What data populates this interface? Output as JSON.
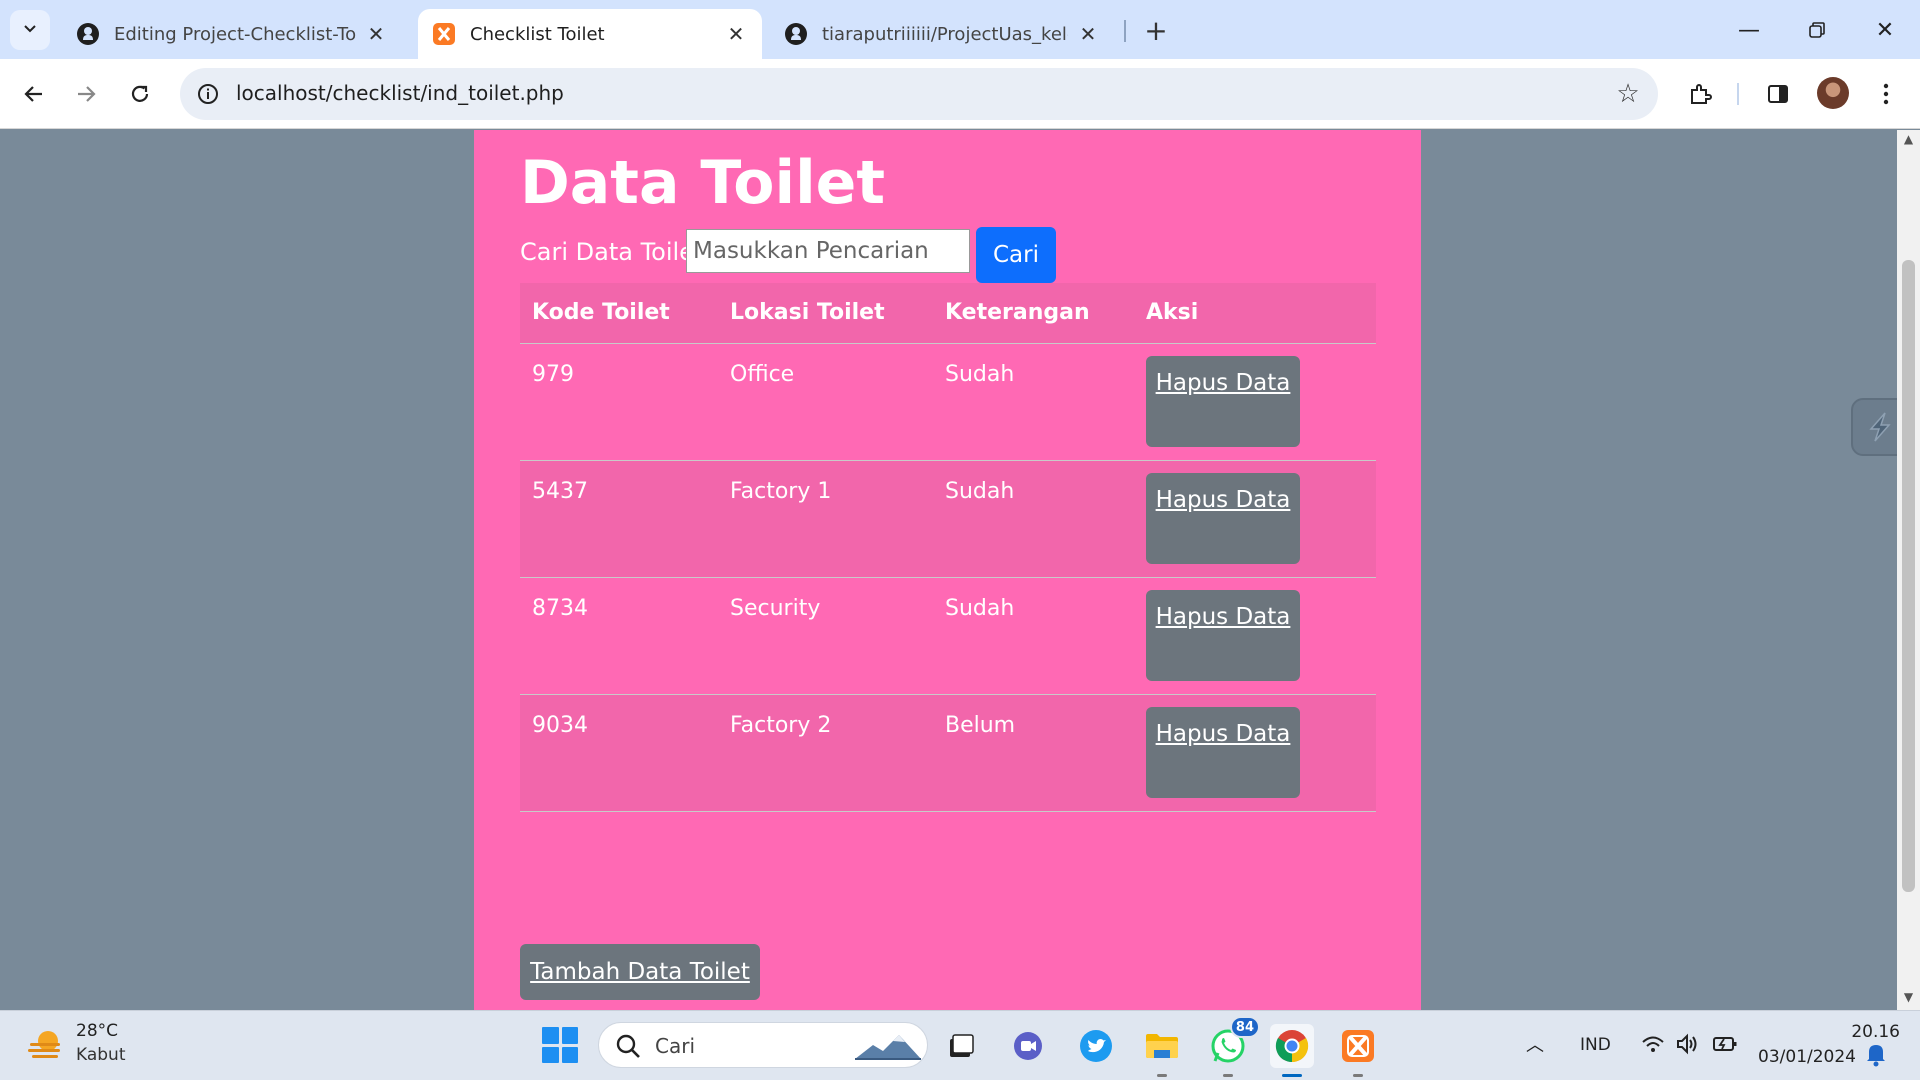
{
  "browser": {
    "tabs": [
      {
        "title": "Editing Project-Checklist-Toilet/",
        "favicon": "github-icon",
        "active": false
      },
      {
        "title": "Checklist Toilet",
        "favicon": "xampp-icon",
        "active": true
      },
      {
        "title": "tiaraputriiiiii/ProjectUas_kelomp",
        "favicon": "github-icon",
        "active": false
      }
    ],
    "url": "localhost/checklist/ind_toilet.php"
  },
  "page": {
    "title": "Data Toilet",
    "search": {
      "label": "Cari Data Toilet",
      "placeholder": "Masukkan Pencarian",
      "value": "",
      "button": "Cari"
    },
    "table": {
      "headers": [
        "Kode Toilet",
        "Lokasi Toilet",
        "Keterangan",
        "Aksi"
      ],
      "rows": [
        {
          "kode": "979",
          "lokasi": "Office",
          "keterangan": "Sudah",
          "aksi": "Hapus Data"
        },
        {
          "kode": "5437",
          "lokasi": "Factory 1",
          "keterangan": "Sudah",
          "aksi": "Hapus Data"
        },
        {
          "kode": "8734",
          "lokasi": "Security",
          "keterangan": "Sudah",
          "aksi": "Hapus Data"
        },
        {
          "kode": "9034",
          "lokasi": "Factory 2",
          "keterangan": "Belum",
          "aksi": "Hapus Data"
        }
      ]
    },
    "add_button": "Tambah Data Toilet"
  },
  "colors": {
    "page_bg": "#798a99",
    "container_bg": "#ff69b4",
    "row_alt_bg": "#f266ab",
    "primary_button": "#0d6efd",
    "secondary_button": "#6c757d"
  },
  "taskbar": {
    "weather": {
      "temp": "28°C",
      "desc": "Kabut"
    },
    "search_text": "Cari",
    "apps": [
      "task-view-icon",
      "meet-icon",
      "twitter-icon",
      "file-explorer-icon",
      "whatsapp-icon",
      "chrome-icon",
      "xampp-icon"
    ],
    "whatsapp_badge": "84",
    "language": "IND",
    "time": "20.16",
    "date": "03/01/2024"
  }
}
